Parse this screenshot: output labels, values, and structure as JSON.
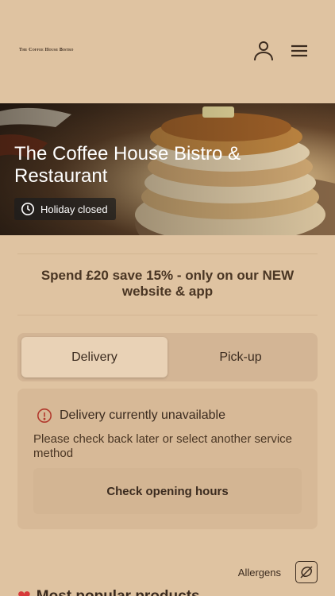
{
  "header": {
    "logo_text": "The Coffee House Bistro",
    "account_icon": "person-icon",
    "menu_icon": "hamburger-menu-icon"
  },
  "hero": {
    "title": "The Coffee House Bistro & Restaurant",
    "status_icon": "clock-icon",
    "status_text": "Holiday closed"
  },
  "promo": {
    "text": "Spend £20 save 15% - only on our NEW website & app"
  },
  "service_toggle": {
    "options": [
      "Delivery",
      "Pick-up"
    ],
    "selected": "Delivery"
  },
  "notice": {
    "icon": "info-circle-icon",
    "title": "Delivery currently unavailable",
    "body": "Please check back later or select another service method",
    "button_label": "Check opening hours"
  },
  "allergens": {
    "label": "Allergens",
    "icon": "allergen-icon"
  },
  "section": {
    "icon": "heart-icon",
    "title": "Most popular products"
  },
  "colors": {
    "background": "#dfc3a1",
    "text": "#3b2b1f",
    "alert": "#b23a2e"
  }
}
